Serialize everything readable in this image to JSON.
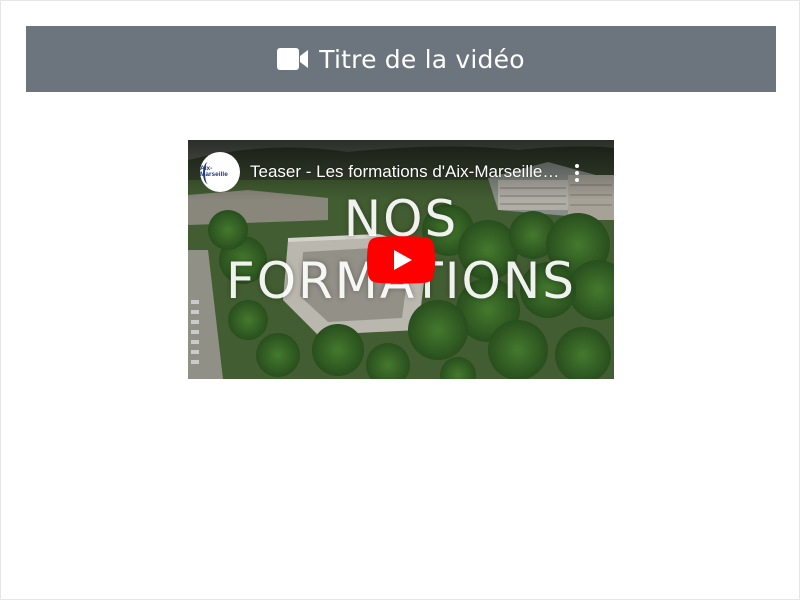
{
  "header": {
    "icon": "video-camera-icon",
    "title": "Titre de la vidéo",
    "background_color": "#6c757d",
    "text_color": "#ffffff"
  },
  "video": {
    "channel_logo": {
      "name": "Aix-Marseille"
    },
    "title": "Teaser - Les formations d'Aix-Marseille Université",
    "overlay_line1": "NOS",
    "overlay_line2": "FORMATIONS",
    "play_icon": "youtube-play-icon",
    "menu_icon": "more-vert-icon",
    "play_button_color": "#ff0000"
  }
}
